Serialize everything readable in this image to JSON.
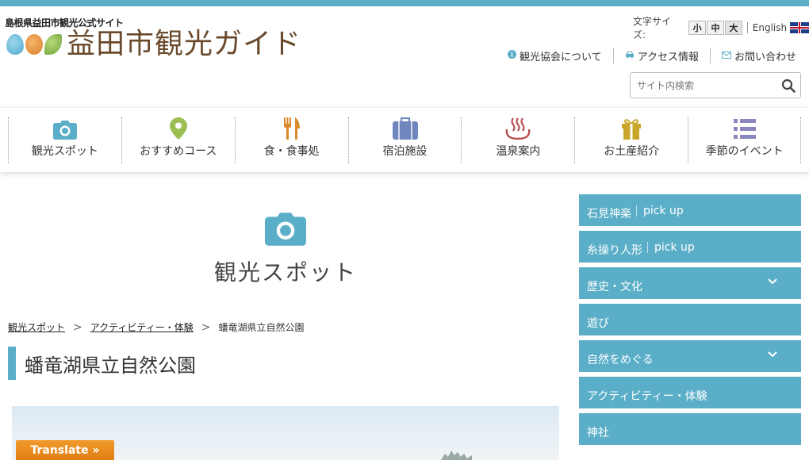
{
  "header": {
    "site_subtitle": "島根県益田市観光公式サイト",
    "logo_text": "益田市観光ガイド",
    "font_size_label": "文字サイズ:",
    "font_sizes": [
      "小",
      "中",
      "大"
    ],
    "english_label": "English",
    "utility_links": [
      "観光協会について",
      "アクセス情報",
      "お問い合わせ"
    ],
    "search_placeholder": "サイト内検索"
  },
  "nav": {
    "items": [
      {
        "label": "観光スポット",
        "icon": "camera-icon"
      },
      {
        "label": "おすすめコース",
        "icon": "map-pin-icon"
      },
      {
        "label": "食・食事処",
        "icon": "fork-knife-icon"
      },
      {
        "label": "宿泊施設",
        "icon": "suitcase-icon"
      },
      {
        "label": "温泉案内",
        "icon": "hot-spring-icon"
      },
      {
        "label": "お土産紹介",
        "icon": "gift-icon"
      },
      {
        "label": "季節のイベント",
        "icon": "list-icon"
      }
    ]
  },
  "page": {
    "section_title": "観光スポット",
    "breadcrumb": [
      "観光スポット",
      "アクティビティー・体験",
      "蟠竜湖県立自然公園"
    ],
    "title": "蟠竜湖県立自然公園"
  },
  "sidebar": {
    "items": [
      {
        "label": "石見神楽",
        "pick": "pick up"
      },
      {
        "label": "糸操り人形",
        "pick": "pick up"
      },
      {
        "label": "歴史・文化"
      },
      {
        "label": "遊び"
      },
      {
        "label": "自然をめぐる"
      },
      {
        "label": "アクティビティー・体験"
      },
      {
        "label": "神社"
      }
    ]
  },
  "translate_label": "Translate »",
  "colors": {
    "accent": "#5aaec8",
    "logo_brown": "#6a4a2c",
    "translate_orange": "#e8891c"
  }
}
